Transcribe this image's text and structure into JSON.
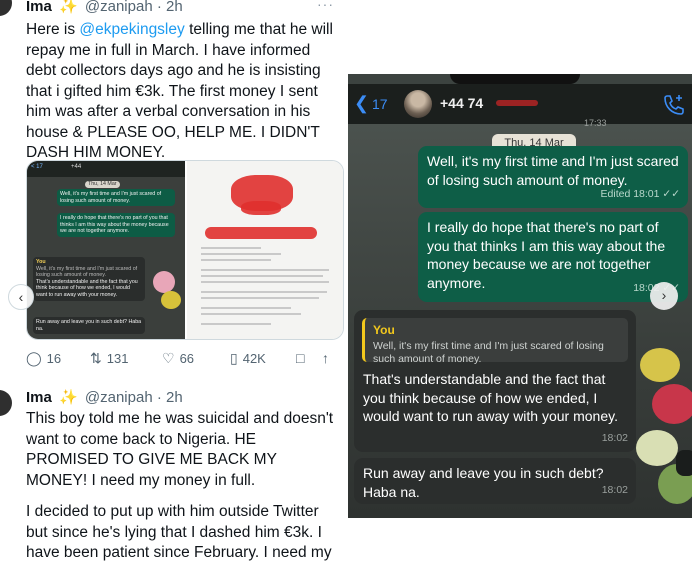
{
  "tweets": [
    {
      "name": "Ima",
      "badge": "✨",
      "handle": "@zanipah · 2h",
      "more": "···",
      "body_pre": "Here is ",
      "mention": "@ekpekingsley",
      "body_post": " telling me that he will repay me in full in March. I have informed debt collectors days ago and he is insisting that i gifted him €3k. The first money I sent him was after a verbal conversation in his house & PLEASE OO, HELP ME. I DIDN'T DASH HIM MONEY.",
      "stats": {
        "replies": "16",
        "reposts": "131",
        "likes": "66",
        "views": "42K"
      }
    },
    {
      "name": "Ima",
      "badge": "✨",
      "handle": "@zanipah · 2h",
      "more": "···",
      "body_p1": "This boy told me he was suicidal and doesn't want to come back to Nigeria. HE PROMISED TO GIVE ME BACK MY MONEY! I need my money in full.",
      "body_p2": "I decided to put up with him outside Twitter but since he's lying that I dashed him €3k. I have been patient since February. I need my"
    }
  ],
  "mini_chat": {
    "back": "< 17",
    "name": "+44",
    "date": "Thu, 14 Mar",
    "m1": "Well, it's my first time and I'm just scared of losing such amount of money.",
    "m2": "I really do hope that there's no part of you that thinks I am this way about the money because we are not together anymore.",
    "you": "You",
    "quote": "Well, it's my first time and I'm just scared of losing such amount of money.",
    "m3": "That's understandable and the fact that you think because of how we ended, I would want to run away with your money.",
    "m4": "Run away and leave you in such debt? Haba na."
  },
  "chat": {
    "back_count": "17",
    "contact": "+44 74",
    "date": "Thu, 14 Mar",
    "top_time": "17:33",
    "messages": [
      {
        "text": "Well, it's my first time and I'm just scared of losing such amount of money.",
        "meta": "Edited 18:01 ✓✓"
      },
      {
        "text": "I really do hope that there's no part of you that thinks I am this way about the money because we are not together anymore.",
        "meta": "18:02 ✓✓"
      },
      {
        "quote_author": "You",
        "quote_text": "Well, it's my first time and I'm just scared of losing such amount of money.",
        "text": "That's understandable and the fact that you think because of how we ended, I would want to run away with your money.",
        "meta": "18:02"
      },
      {
        "text": "Run away and leave you in such debt? Haba na.",
        "meta": "18:02"
      }
    ]
  },
  "colors": {
    "mention": "#1d9bf0",
    "outgoing_bubble": "#0e5e47",
    "incoming_bubble": "#2b2e2d",
    "quote_accent": "#f2c81d",
    "ios_blue": "#3b8cf5"
  },
  "icons": [
    "chevron-left-icon",
    "reply-icon",
    "repost-icon",
    "like-icon",
    "views-icon",
    "bookmark-icon",
    "call-add-icon",
    "chevron-right-icon"
  ]
}
